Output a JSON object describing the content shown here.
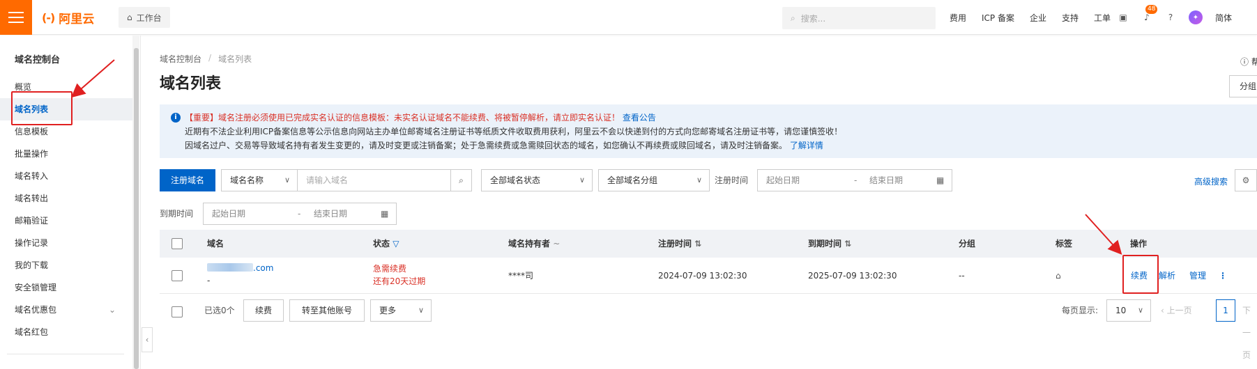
{
  "topbar": {
    "logo_text": "阿里云",
    "logo_mark": "(-)",
    "workbench_label": "工作台",
    "search_placeholder": "搜索...",
    "links": [
      "费用",
      "ICP 备案",
      "企业",
      "支持",
      "工单"
    ],
    "notification_count": "48",
    "language": "简体"
  },
  "sidebar": {
    "title": "域名控制台",
    "items": [
      {
        "label": "概览"
      },
      {
        "label": "域名列表"
      },
      {
        "label": "信息模板"
      },
      {
        "label": "批量操作"
      },
      {
        "label": "域名转入"
      },
      {
        "label": "域名转出"
      },
      {
        "label": "邮箱验证"
      },
      {
        "label": "操作记录"
      },
      {
        "label": "我的下载"
      },
      {
        "label": "安全锁管理"
      },
      {
        "label": "域名优惠包"
      },
      {
        "label": "域名红包"
      }
    ]
  },
  "main": {
    "breadcrumb": [
      "域名控制台",
      "域名列表"
    ],
    "breadcrumb_sep": "/",
    "page_title": "域名列表",
    "help_label": "帮",
    "group_button": "分组",
    "notice": {
      "line1_red": "【重要】域名注册必须使用已完成实名认证的信息模板：未实名认证域名不能续费、将被暂停解析，请立即实名认证！",
      "line1_link": "查看公告",
      "line2": "近期有不法企业利用ICP备案信息等公示信息向网站主办单位邮寄域名注册证书等纸质文件收取费用获利，阿里云不会以快递到付的方式向您邮寄域名注册证书等，请您谨慎签收！",
      "line3": "因域名过户、交易等导致域名持有者发生变更的，请及时变更或注销备案；处于急需续费或急需赎回状态的域名，如您确认不再续费或赎回域名，请及时注销备案。",
      "line3_link": "了解详情"
    },
    "filters": {
      "register_button": "注册域名",
      "name_select": "域名名称",
      "name_placeholder": "请输入域名",
      "status_select": "全部域名状态",
      "group_select": "全部域名分组",
      "reg_time_label": "注册时间",
      "start_date": "起始日期",
      "end_date": "结束日期",
      "range_sep": "-",
      "exp_time_label": "到期时间",
      "advanced_search": "高级搜索"
    },
    "table": {
      "headers": [
        "域名",
        "状态",
        "域名持有者",
        "注册时间",
        "到期时间",
        "分组",
        "标签",
        "操作"
      ],
      "rows": [
        {
          "domain_suffix": ".com",
          "domain_sub": "-",
          "status_line1": "急需续费",
          "status_line2": "还有20天过期",
          "holder": "****司",
          "reg_time": "2024-07-09 13:02:30",
          "exp_time": "2025-07-09 13:02:30",
          "group": "--",
          "actions": [
            "续费",
            "解析",
            "管理"
          ]
        }
      ]
    },
    "footer": {
      "selected": "已选0个",
      "renew_button": "续费",
      "transfer_button": "转至其他账号",
      "more_select": "更多",
      "page_size_label": "每页显示:",
      "page_size": "10",
      "prev": "上一页",
      "current_page": "1",
      "next": "下一页"
    }
  },
  "colors": {
    "brand_orange": "#ff6a00",
    "link_blue": "#0064c8",
    "alert_red": "#d93026",
    "annotation_red": "#e02020"
  }
}
